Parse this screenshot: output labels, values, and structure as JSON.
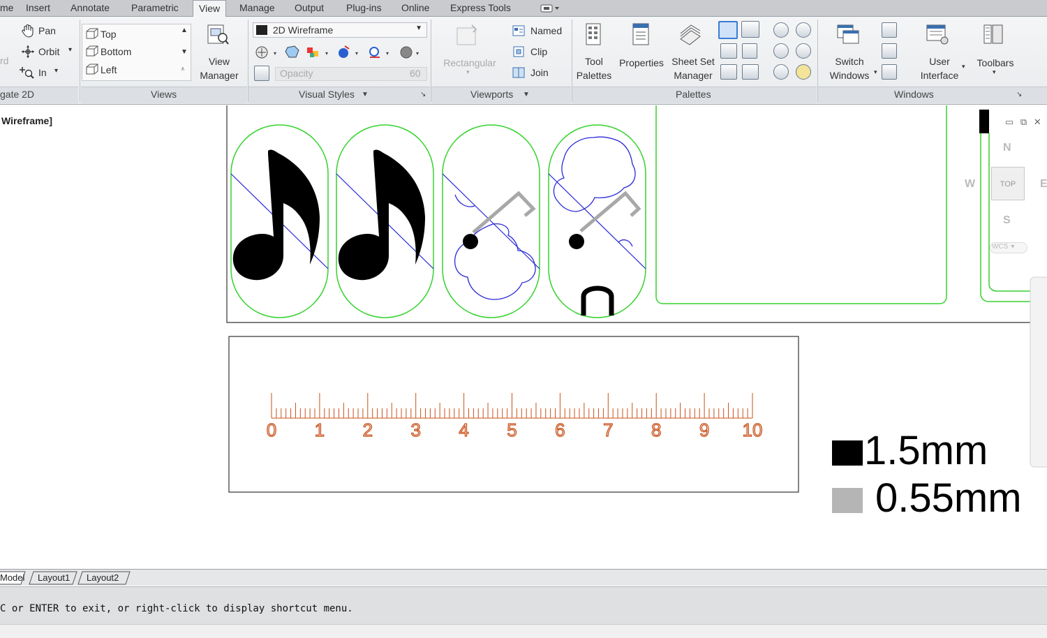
{
  "tabs": [
    {
      "label": "me"
    },
    {
      "label": "Insert"
    },
    {
      "label": "Annotate"
    },
    {
      "label": "Parametric"
    },
    {
      "label": "View"
    },
    {
      "label": "Manage"
    },
    {
      "label": "Output"
    },
    {
      "label": "Plug-ins"
    },
    {
      "label": "Online"
    },
    {
      "label": "Express Tools"
    }
  ],
  "navigate": {
    "pan": "Pan",
    "orbit": "Orbit",
    "zoom": "In",
    "left_cut": "rd",
    "title": "gate 2D"
  },
  "views": {
    "items": [
      "Top",
      "Bottom",
      "Left"
    ],
    "view_manager_line1": "View",
    "view_manager_line2": "Manager",
    "title": "Views"
  },
  "visual_styles": {
    "current": "2D Wireframe",
    "opacity_label": "Opacity",
    "opacity_value": "60",
    "title": "Visual Styles"
  },
  "viewports": {
    "rectangular": "Rectangular",
    "named": "Named",
    "clip": "Clip",
    "join": "Join",
    "title": "Viewports"
  },
  "palettes": {
    "tool_palettes_1": "Tool",
    "tool_palettes_2": "Palettes",
    "properties": "Properties",
    "sheet_set_1": "Sheet Set",
    "sheet_set_2": "Manager",
    "title": "Palettes"
  },
  "windows": {
    "switch_1": "Switch",
    "switch_2": "Windows",
    "ui_1": "User",
    "ui_2": "Interface",
    "toolbars": "Toolbars",
    "title": "Windows"
  },
  "viewport": {
    "label": "Wireframe]",
    "viewcube_top": "TOP",
    "compass_n": "N",
    "compass_s": "S",
    "compass_w": "W",
    "compass_e": "E",
    "wcs": "WCS"
  },
  "ruler": {
    "numbers": [
      "0",
      "1",
      "2",
      "3",
      "4",
      "5",
      "6",
      "7",
      "8",
      "9",
      "10"
    ]
  },
  "legend": {
    "black_label": "1.5mm",
    "gray_label": "0.55mm",
    "black_color": "#000000",
    "gray_color": "#b5b5b5"
  },
  "colors": {
    "green": "#35d22e",
    "blue": "#2a2ad8",
    "gray_stroke": "#a8a8a8",
    "ruler": "#c8501a"
  },
  "layout_tabs": [
    "Model",
    "Layout1",
    "Layout2"
  ],
  "command": {
    "text": "C or ENTER to exit, or right-click to display shortcut menu."
  }
}
